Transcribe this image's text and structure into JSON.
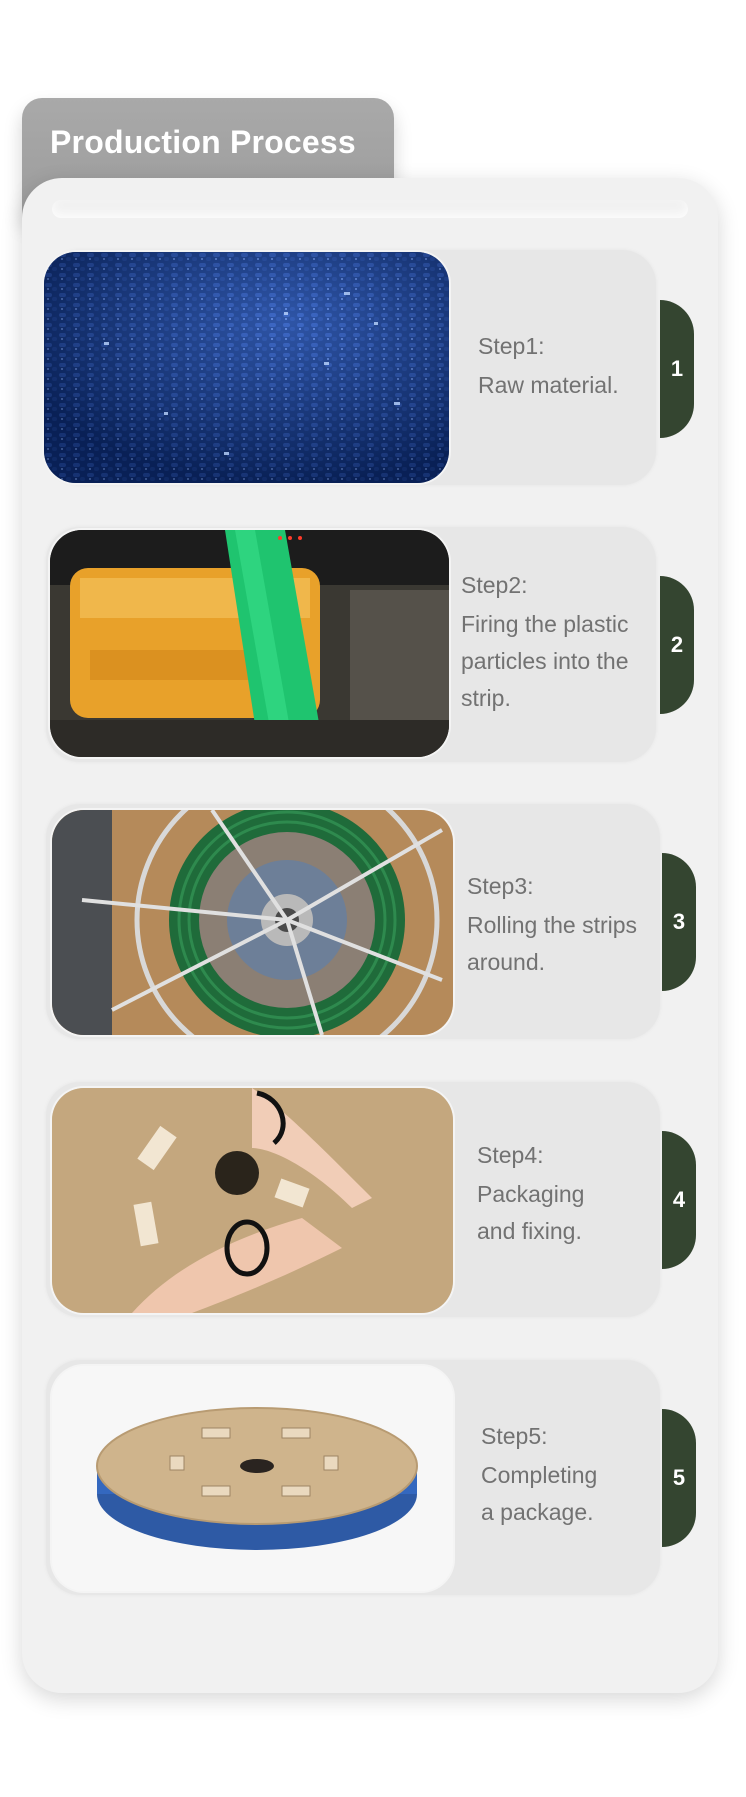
{
  "header": {
    "title": "Production Process"
  },
  "steps": [
    {
      "number": "1",
      "label": "Step1:",
      "lines": [
        "Raw material."
      ]
    },
    {
      "number": "2",
      "label": "Step2:",
      "lines": [
        "Firing the plastic",
        "particles into the",
        "strip."
      ]
    },
    {
      "number": "3",
      "label": "Step3:",
      "lines": [
        "Rolling the strips",
        "around."
      ]
    },
    {
      "number": "4",
      "label": "Step4:",
      "lines": [
        "Packaging",
        "and fixing."
      ]
    },
    {
      "number": "5",
      "label": "Step5:",
      "lines": [
        "Completing",
        "a package."
      ]
    }
  ],
  "colors": {
    "badge": "#344530",
    "tab": "#a3a3a3",
    "panel": "#f1f1f1",
    "card": "#e7e7e7",
    "text": "#727272"
  }
}
